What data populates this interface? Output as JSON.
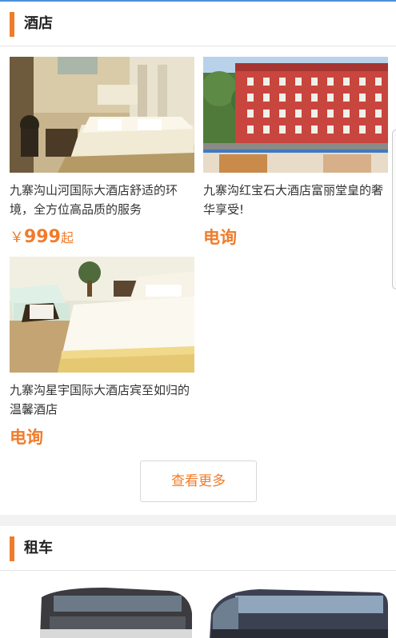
{
  "hotel_section": {
    "title": "酒店",
    "cards": [
      {
        "title": "九寨沟山河国际大酒店舒适的环境，全方位高品质的服务",
        "price_symbol": "￥",
        "price_value": "999",
        "price_suffix": "起"
      },
      {
        "title": "九寨沟红宝石大酒店富丽堂皇的奢华享受!",
        "price_call": "电询"
      },
      {
        "title": "九寨沟星宇国际大酒店宾至如归的温馨酒店",
        "price_call": "电询"
      }
    ],
    "more_label": "查看更多"
  },
  "car_section": {
    "title": "租车"
  },
  "colors": {
    "accent": "#f07c2b",
    "top_line": "#4a90d9",
    "background": "#f2f2f2"
  }
}
